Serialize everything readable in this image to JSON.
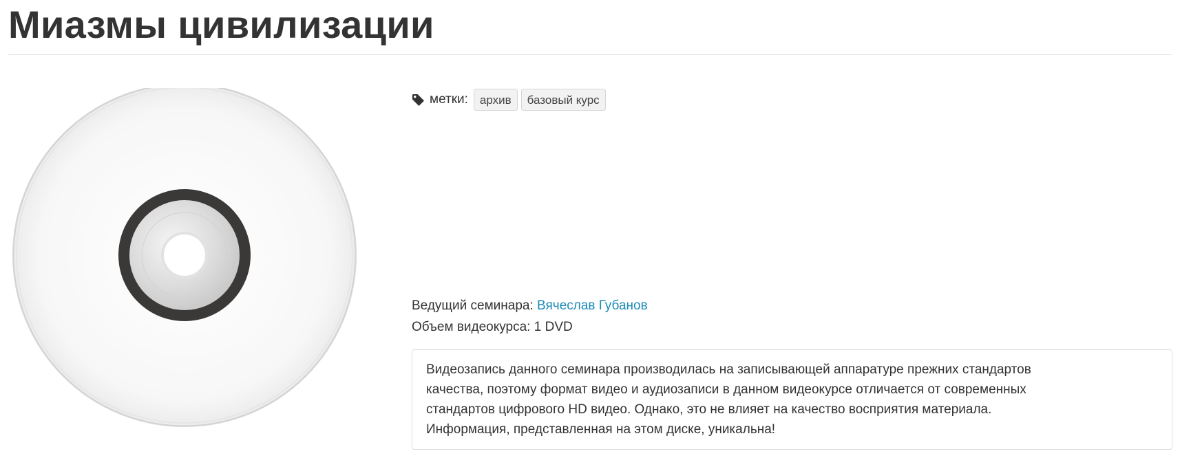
{
  "page": {
    "title": "Миазмы цивилизации"
  },
  "tags": {
    "icon": "tag-icon",
    "label": "метки:",
    "items": [
      "архив",
      "базовый курс"
    ]
  },
  "details": {
    "host_label": "Ведущий семинара:",
    "host_name": "Вячеслав Губанов",
    "volume_label": "Объем видеокурса:",
    "volume_value": "1 DVD"
  },
  "note": {
    "lines": [
      "Видеозапись данного семинара производилась на записывающей аппаратуре прежних стандартов",
      "качества, поэтому формат видео и аудиозаписи в данном видеокурсе отличается от современных",
      "стандартов цифрового HD видео. Однако, это не влияет на качество восприятия материала.",
      "Информация, представленная на этом диске, уникальна!"
    ]
  },
  "colors": {
    "link": "#1d8bb8",
    "title": "#333333",
    "tag_bg": "#f2f2f2"
  }
}
